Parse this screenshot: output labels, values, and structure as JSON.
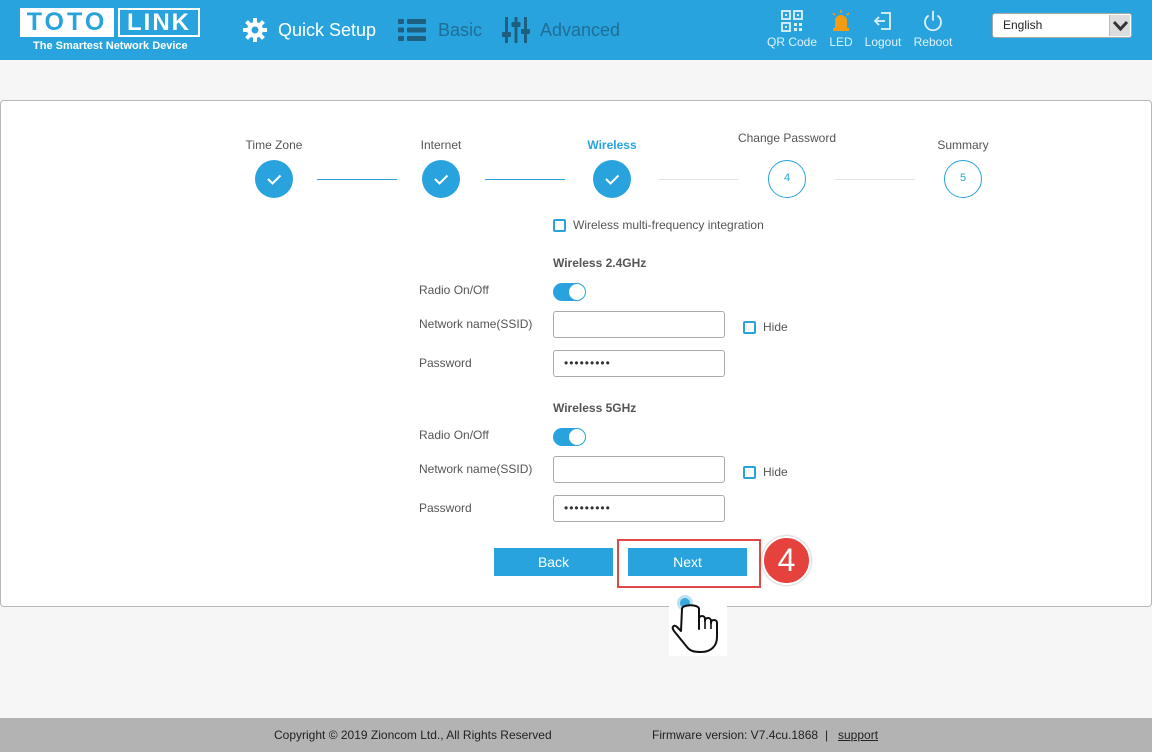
{
  "brand": {
    "name_a": "TOTO",
    "name_b": "LINK",
    "tagline": "The Smartest Network Device"
  },
  "nav": {
    "quick_setup": "Quick Setup",
    "basic": "Basic",
    "advanced": "Advanced"
  },
  "tools": {
    "qr_code": "QR Code",
    "led": "LED",
    "logout": "Logout",
    "reboot": "Reboot"
  },
  "language": {
    "selected": "English"
  },
  "steps": [
    {
      "label": "Time Zone",
      "state": "done"
    },
    {
      "label": "Internet",
      "state": "done"
    },
    {
      "label": "Wireless",
      "state": "active"
    },
    {
      "label": "Change Password",
      "number": "4",
      "state": "todo"
    },
    {
      "label": "Summary",
      "number": "5",
      "state": "todo"
    }
  ],
  "wireless": {
    "multi_freq_label": "Wireless multi-frequency integration",
    "band_24": {
      "title": "Wireless 2.4GHz",
      "radio_label": "Radio On/Off",
      "ssid_label": "Network name(SSID)",
      "ssid_value": "",
      "hide_label": "Hide",
      "password_label": "Password",
      "password_value": "•••••••••"
    },
    "band_5": {
      "title": "Wireless 5GHz",
      "radio_label": "Radio On/Off",
      "ssid_label": "Network name(SSID)",
      "ssid_value": "",
      "hide_label": "Hide",
      "password_label": "Password",
      "password_value": "•••••••••"
    }
  },
  "buttons": {
    "back": "Back",
    "next": "Next"
  },
  "annotation": {
    "step_number": "4"
  },
  "colors": {
    "accent": "#29a3dd",
    "annotation_red": "#e5413d",
    "footer": "#b3b3b3"
  },
  "footer": {
    "copyright": "Copyright © 2019 Zioncom Ltd., All Rights Reserved",
    "firmware": "Firmware version: V7.4cu.1868",
    "separator": "|",
    "support": "support"
  }
}
